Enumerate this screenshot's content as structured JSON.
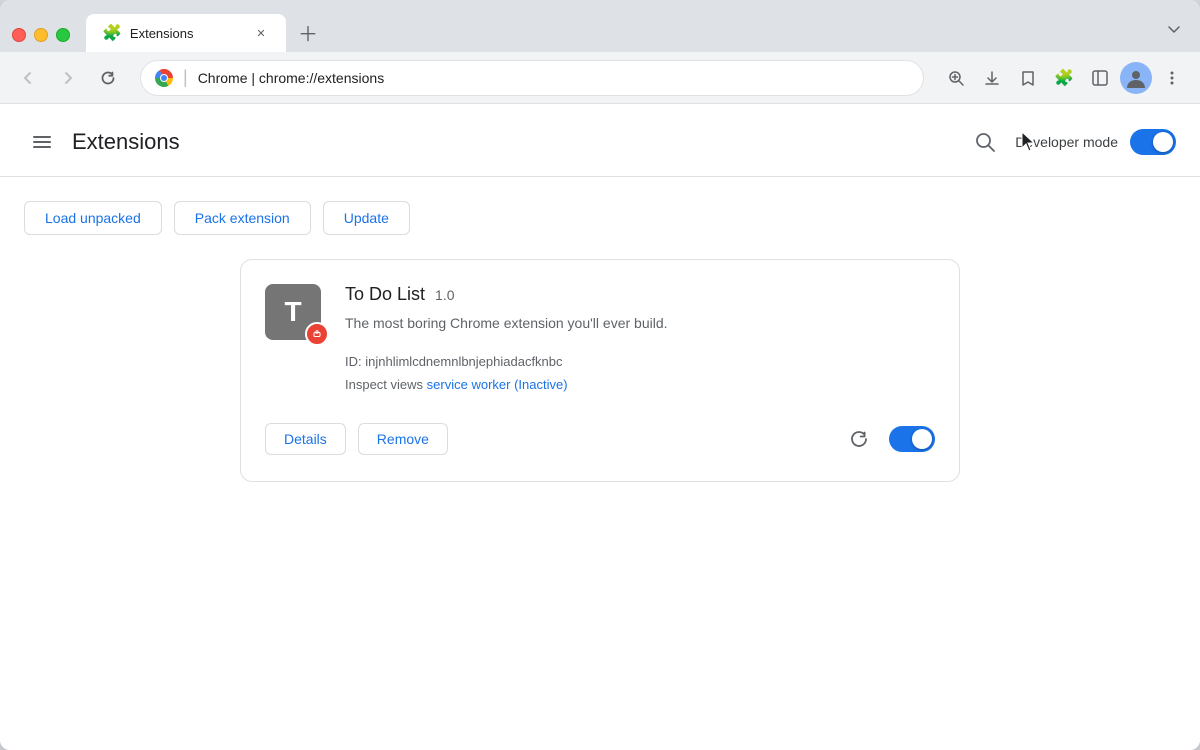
{
  "browser": {
    "tab_title": "Extensions",
    "tab_icon": "puzzle",
    "address_bar": {
      "site_label": "Chrome",
      "url": "chrome://extensions"
    },
    "tab_list_icon": "chevron-down",
    "new_tab_icon": "plus"
  },
  "nav": {
    "back": "←",
    "forward": "→",
    "refresh": "↺"
  },
  "page": {
    "menu_icon": "hamburger",
    "title": "Extensions",
    "search_icon": "search",
    "dev_mode_label": "Developer mode",
    "dev_mode_enabled": true,
    "actions": [
      {
        "id": "load-unpacked",
        "label": "Load unpacked"
      },
      {
        "id": "pack-extension",
        "label": "Pack extension"
      },
      {
        "id": "update",
        "label": "Update"
      }
    ]
  },
  "extensions": [
    {
      "id": "todo-list",
      "icon_letter": "T",
      "icon_bg": "#757575",
      "badge_icon": "camera",
      "name": "To Do List",
      "version": "1.0",
      "description": "The most boring Chrome extension you'll ever build.",
      "ext_id": "injnhlimlcdnemnlbnjephiadacfknbc",
      "inspect_views_label": "Inspect views",
      "service_worker_link": "service worker (Inactive)",
      "details_label": "Details",
      "remove_label": "Remove",
      "enabled": true
    }
  ]
}
